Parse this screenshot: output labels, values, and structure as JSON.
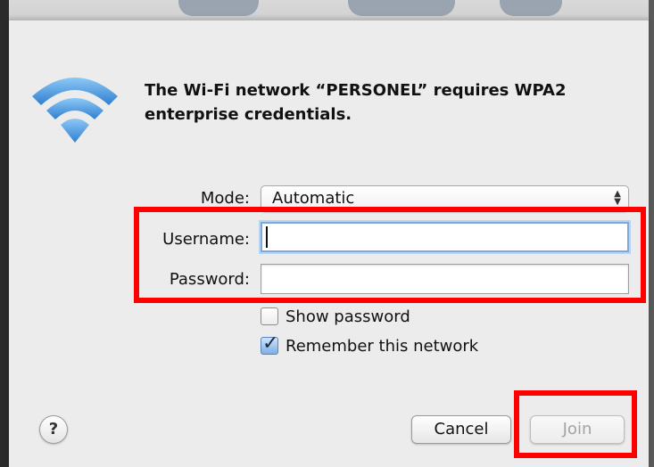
{
  "dialog": {
    "message_part1": "The Wi-Fi network “",
    "network_name": "PERSONEL",
    "message_part2": "” requires WPA2 enterprise credentials."
  },
  "form": {
    "mode_label": "Mode:",
    "mode_value": "Automatic",
    "username_label": "Username:",
    "username_value": "",
    "password_label": "Password:",
    "password_value": ""
  },
  "options": {
    "show_password_label": "Show password",
    "show_password_checked": false,
    "remember_network_label": "Remember this network",
    "remember_network_checked": true
  },
  "buttons": {
    "help_label": "?",
    "cancel_label": "Cancel",
    "join_label": "Join",
    "join_enabled": false
  },
  "colors": {
    "highlight": "#ff0000",
    "wifi_icon": "#4a9be0",
    "focus_ring": "#7fa9db"
  },
  "icons": {
    "wifi": "wifi-icon",
    "select_arrows": "select-arrows-icon",
    "checkmark": "checkmark-icon"
  }
}
